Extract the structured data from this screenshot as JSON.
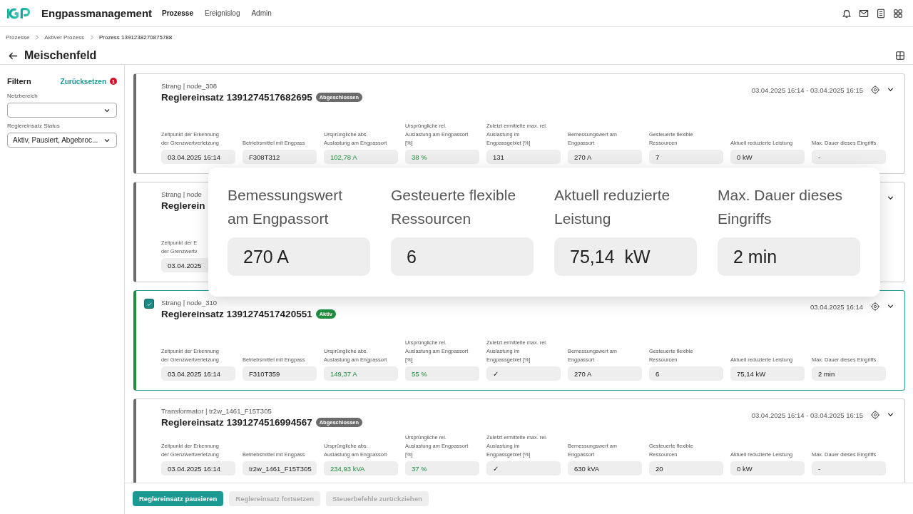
{
  "app": {
    "title": "Engpassmanagement",
    "nav": [
      {
        "label": "Prozesse",
        "selected": true
      },
      {
        "label": "Ereignislog",
        "selected": false
      },
      {
        "label": "Admin",
        "selected": false
      }
    ]
  },
  "breadcrumb": [
    "Prozesse",
    "Aktiver Prozess",
    "Prozess 1391238270875788"
  ],
  "page_title": "Meischenfeld",
  "filters": {
    "title": "Filtern",
    "reset": "Zurücksetzen",
    "count": "1",
    "fields": [
      {
        "label": "Netzbereich"
      },
      {
        "label": "Reglereinsatz Status",
        "value": "Aktiv, Pausiert, Abgebroc..."
      }
    ]
  },
  "cards": [
    {
      "subtitle": "Strang | node_308",
      "title": "Reglereinsatz 1391274517682695",
      "status": {
        "label": "Abgeschlossen",
        "kind": "closed"
      },
      "time": "03.04.2025 16:14 - 03.04.2025 16:15",
      "selected": false,
      "fields": [
        {
          "label_lines": [
            "Zeitpunkt der Erkennung",
            "der Grenzwertverletzung"
          ],
          "value": "03.04.2025 16:14",
          "highlight": false
        },
        {
          "label_lines": [
            "Betriebsmittel mit Engpass"
          ],
          "value": "F308T312",
          "highlight": false
        },
        {
          "label_lines": [
            "Ursprüngliche abs.",
            "Auslastung am Engpassort"
          ],
          "value": "102,78 A",
          "highlight": true
        },
        {
          "label_lines": [
            "Ursprüngliche rel.",
            "Auslastung am Engpassort",
            "[%]"
          ],
          "value": "38 %",
          "highlight": true
        },
        {
          "label_lines": [
            "Zuletzt ermittelte max. rel.",
            "Auslastung im",
            "Engpassgebiet [%]"
          ],
          "value": "131",
          "highlight": false
        },
        {
          "label_lines": [
            "Bemessungswert am",
            "Engpassort"
          ],
          "value": "270 A",
          "highlight": false
        },
        {
          "label_lines": [
            "Gesteuerte flexible",
            "Ressourcen"
          ],
          "value": "7",
          "highlight": false
        },
        {
          "label_lines": [
            "Aktuell reduzierte Leistung"
          ],
          "value": "0 kW",
          "highlight": false
        },
        {
          "label_lines": [
            "Max. Dauer dieses Eingriffs"
          ],
          "value": "-",
          "highlight": false
        }
      ]
    },
    {
      "subtitle": "Strang | node",
      "title": "Reglerein",
      "selected": false,
      "fields": [
        {
          "label_lines": [
            "Zeitpunkt der E",
            "der Grenzwertv"
          ],
          "value": "03.04.2025",
          "highlight": false
        }
      ]
    },
    {
      "subtitle": "Strang | node_310",
      "title": "Reglereinsatz 1391274517420551",
      "status": {
        "label": "Aktiv",
        "kind": "active"
      },
      "time": "03.04.2025 16:14",
      "selected": true,
      "fields": [
        {
          "label_lines": [
            "Zeitpunkt der Erkennung",
            "der Grenzwertverletzung"
          ],
          "value": "03.04.2025 16:14",
          "highlight": false
        },
        {
          "label_lines": [
            "Betriebsmittel mit Engpass"
          ],
          "value": "F310T359",
          "highlight": false
        },
        {
          "label_lines": [
            "Ursprüngliche abs.",
            "Auslastung am Engpassort"
          ],
          "value": "149,37 A",
          "highlight": true
        },
        {
          "label_lines": [
            "Ursprüngliche rel.",
            "Auslastung am Engpassort",
            "[%]"
          ],
          "value": "55 %",
          "highlight": true
        },
        {
          "label_lines": [
            "Zuletzt ermittelte max. rel.",
            "Auslastung im",
            "Engpassgebiet [%]"
          ],
          "value": "✓",
          "highlight": false
        },
        {
          "label_lines": [
            "Bemessungswert am",
            "Engpassort"
          ],
          "value": "270 A",
          "highlight": false
        },
        {
          "label_lines": [
            "Gesteuerte flexible",
            "Ressourcen"
          ],
          "value": "6",
          "highlight": false
        },
        {
          "label_lines": [
            "Aktuell reduzierte Leistung"
          ],
          "value": "75,14 kW",
          "highlight": false
        },
        {
          "label_lines": [
            "Max. Dauer dieses Eingriffs"
          ],
          "value": "2 min",
          "highlight": false
        }
      ]
    },
    {
      "subtitle": "Transformator | tr2w_1461_F15T305",
      "title": "Reglereinsatz 1391274516994567",
      "status": {
        "label": "Abgeschlossen",
        "kind": "closed"
      },
      "time": "03.04.2025 16:14 - 03.04.2025 16:15",
      "selected": false,
      "fields": [
        {
          "label_lines": [
            "Zeitpunkt der Erkennung",
            "der Grenzwertverletzung"
          ],
          "value": "03.04.2025 16:14",
          "highlight": false
        },
        {
          "label_lines": [
            "Betriebsmittel mit Engpass"
          ],
          "value": "tr2w_1461_F15T305",
          "highlight": false
        },
        {
          "label_lines": [
            "Ursprüngliche abs.",
            "Auslastung am Engpassort"
          ],
          "value": "234,93 kVA",
          "highlight": true
        },
        {
          "label_lines": [
            "Ursprüngliche rel.",
            "Auslastung am Engpassort",
            "[%]"
          ],
          "value": "37 %",
          "highlight": true
        },
        {
          "label_lines": [
            "Zuletzt ermittelte max. rel.",
            "Auslastung im",
            "Engpassgebiet [%]"
          ],
          "value": "✓",
          "highlight": false
        },
        {
          "label_lines": [
            "Bemessungswert am",
            "Engpassort"
          ],
          "value": "630 kVA",
          "highlight": false
        },
        {
          "label_lines": [
            "Gesteuerte flexible",
            "Ressourcen"
          ],
          "value": "20",
          "highlight": false
        },
        {
          "label_lines": [
            "Aktuell reduzierte Leistung"
          ],
          "value": "0 kW",
          "highlight": false
        },
        {
          "label_lines": [
            "Max. Dauer dieses Eingriffs"
          ],
          "value": "-",
          "highlight": false
        }
      ]
    }
  ],
  "zoom_panel": [
    {
      "label_lines": [
        "Bemessungswert",
        "am Engpassort"
      ],
      "value": "270 A"
    },
    {
      "label_lines": [
        "Gesteuerte flexible",
        "Ressourcen"
      ],
      "value": "6"
    },
    {
      "label_lines": [
        "Aktuell reduzierte",
        "Leistung"
      ],
      "value": "75,14  kW"
    },
    {
      "label_lines": [
        "Max. Dauer dieses",
        "Eingriffs"
      ],
      "value": "2 min"
    }
  ],
  "actions": [
    {
      "label": "Reglereinsatz pausieren",
      "disabled": false
    },
    {
      "label": "Reglereinsatz fortsetzen",
      "disabled": true
    },
    {
      "label": "Steuerbefehle zurückziehen",
      "disabled": true
    }
  ]
}
